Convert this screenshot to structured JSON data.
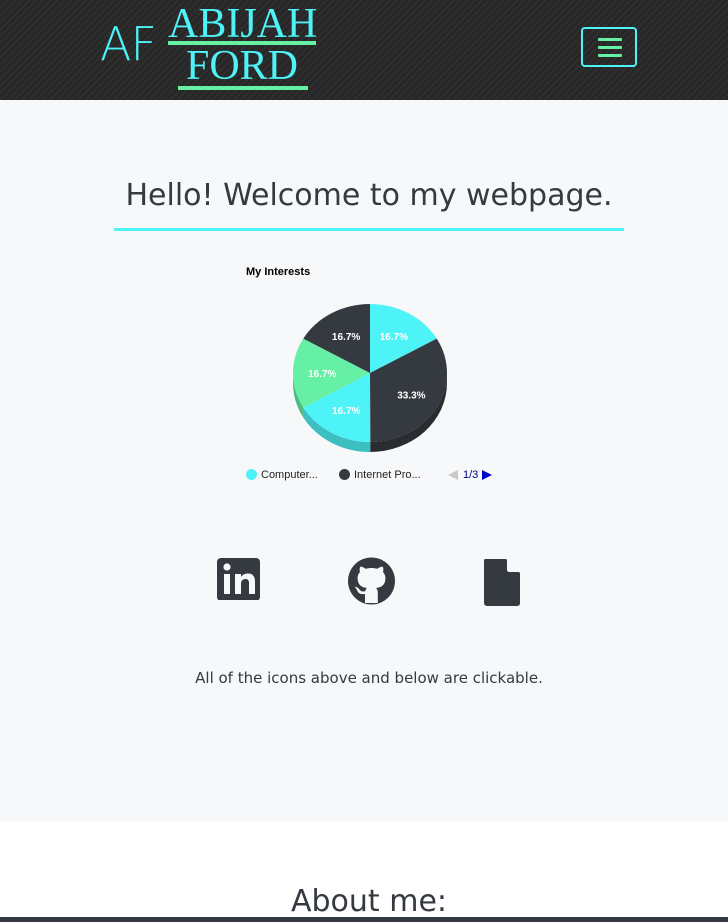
{
  "colors": {
    "accent": "#4ef3f7",
    "accent_green": "#66f0a5",
    "dark": "#343a40",
    "navbar_bg": "#272727",
    "hero_bg": "#f7f8fa"
  },
  "navbar": {
    "logo_initials": "AF",
    "logo_line1": "ABIJAH",
    "logo_line2": "FORD",
    "menu_icon": "hamburger-icon"
  },
  "hero": {
    "title": "Hello! Welcome to my webpage.",
    "note": "All of the icons above and below are clickable."
  },
  "chart_data": {
    "type": "pie",
    "title": "My Interests",
    "slices": [
      {
        "label": "Computer...",
        "value": 16.7,
        "display": "16.7%",
        "color": "#4ef3f7"
      },
      {
        "label": "Internet Pro...",
        "value": 33.3,
        "display": "33.3%",
        "color": "#343a40"
      },
      {
        "label": "",
        "value": 16.7,
        "display": "16.7%",
        "color": "#4ef3f7"
      },
      {
        "label": "",
        "value": 16.7,
        "display": "16.7%",
        "color": "#66f0a5"
      },
      {
        "label": "",
        "value": 16.7,
        "display": "16.7%",
        "color": "#343a40"
      }
    ],
    "legend": [
      {
        "label": "Computer...",
        "color": "#4ef3f7"
      },
      {
        "label": "Internet Pro...",
        "color": "#343a40"
      }
    ],
    "legend_page": "1/3",
    "legend_placement": "bottom",
    "is_3d": true
  },
  "social": [
    {
      "icon": "linkedin-icon"
    },
    {
      "icon": "github-icon"
    },
    {
      "icon": "document-icon"
    }
  ],
  "about": {
    "title": "About me:"
  }
}
